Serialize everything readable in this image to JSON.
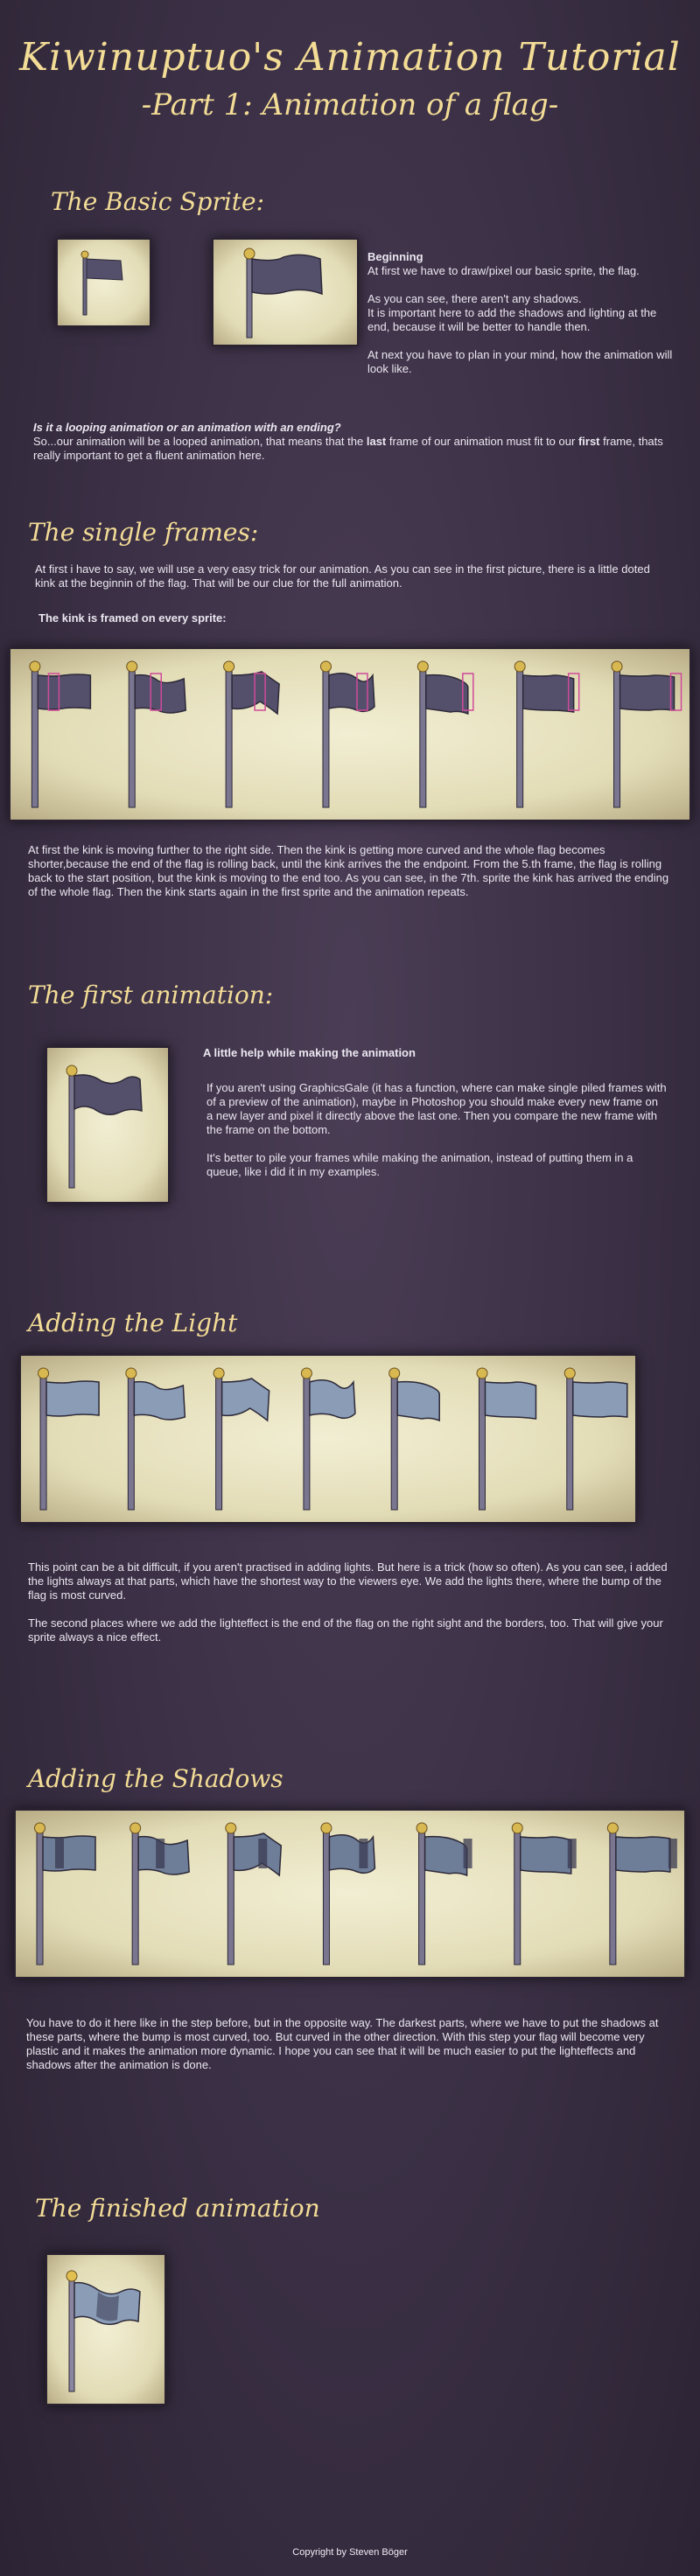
{
  "header": {
    "title": "Kiwinuptuo's Animation Tutorial",
    "subtitle": "-Part 1: Animation of a flag-"
  },
  "basic_sprite": {
    "heading": "The Basic Sprite:",
    "beginning_title": "Beginning",
    "p1": "At first we have to draw/pixel our basic sprite, the flag.",
    "p2a": "As you can see, there aren't any shadows.",
    "p2b": "It is important here to add the shadows and lighting at the end, because it will be better to handle then.",
    "p3": "At next you have to plan in your mind, how the animation will look like.",
    "question": "Is it a looping animation or an animation with an ending?",
    "answer_1": "So...our animation will be a looped animation, that means that the",
    "answer_last": "last",
    "answer_2": "frame of our animation must fit to our",
    "answer_first": "first",
    "answer_3": "frame, thats really important to get a fluent animation here."
  },
  "single_frames": {
    "heading": "The single frames:",
    "intro": "At first i have to say, we will use a very easy trick for our animation. As you can see in the first picture, there is a little doted kink at the beginnin of the flag. That will be our clue for the full animation.",
    "kink_label": "The kink is framed on every sprite:",
    "desc": "At first the kink is moving further to the right side. Then the kink is getting more curved and the whole flag becomes shorter,because the end of the flag is rolling back, until the kink arrives the the endpoint. From the 5.th frame, the flag is rolling back to the start position, but the kink is moving to the end too. As you can see, in the 7th. sprite the kink has arrived the ending of the whole flag. Then the kink starts again in the first sprite and the animation repeats."
  },
  "first_animation": {
    "heading": "The first animation:",
    "help_title": "A little help while making the animation",
    "p1": "If you aren't using GraphicsGale (it has a function, where can make single piled frames with of a preview of the animation), maybe in Photoshop you should make every new frame on a new layer and pixel it directly above the last one. Then you compare the new frame with the frame on the bottom.",
    "p2": "It's better to pile your frames while making the animation, instead of putting them in a queue, like i did it in my examples."
  },
  "light": {
    "heading": "Adding the Light",
    "p1": "This point can be a bit difficult, if you aren't practised in adding lights. But here is a trick (how so often). As you can see, i added the lights always at that parts, which have the shortest way to the viewers eye. We add the lights there, where the bump of the flag is most curved.",
    "p2": "The second places where we add the lighteffect is the end of the flag on the right sight and the borders, too. That will give your sprite always a nice effect."
  },
  "shadows": {
    "heading": "Adding the Shadows",
    "p1": "You have to do it here like in the step before, but in the opposite way. The darkest parts, where we have to put the shadows at these parts, where the bump is most curved, too. But curved in the other direction. With this step your flag will become very plastic and it makes the animation more dynamic. I hope you can see that it will be much easier to put the lighteffects and shadows after the animation is done."
  },
  "finished": {
    "heading": "The finished animation"
  },
  "footer": {
    "copyright": "Copyright by Steven Böger"
  },
  "colors": {
    "title": "#f3dc96",
    "flag_plain": "#54506c",
    "flag_lit": "#8a9cb6",
    "kink_box": "#d04a9a"
  }
}
